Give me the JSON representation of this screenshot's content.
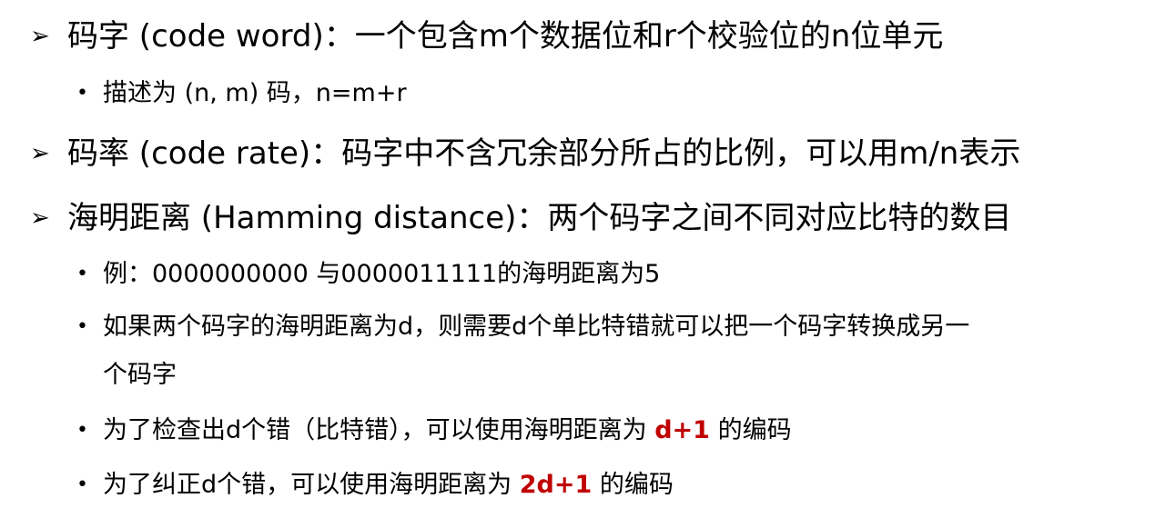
{
  "bullets": {
    "level1_marker": "➢",
    "level2_marker": "•"
  },
  "items": [
    {
      "level": 1,
      "text": "码字 (code word)：一个包含m个数据位和r个校验位的n位单元"
    },
    {
      "level": 2,
      "text": "描述为 (n, m) 码，n=m+r"
    },
    {
      "level": 1,
      "text": "码率 (code rate)：码字中不含冗余部分所占的比例，可以用m/n表示"
    },
    {
      "level": 1,
      "text": "海明距离 (Hamming distance)：两个码字之间不同对应比特的数目"
    },
    {
      "level": 2,
      "text": "例：0000000000 与0000011111的海明距离为5"
    },
    {
      "level": 2,
      "text_line1": "如果两个码字的海明距离为d，则需要d个单比特错就可以把一个码字转换成另一",
      "text_line2": "个码字"
    },
    {
      "level": 2,
      "before": "为了检查出d个错（比特错），可以使用海明距离为 ",
      "highlight": "d+1",
      "after": " 的编码"
    },
    {
      "level": 2,
      "before": "为了纠正d个错，可以使用海明距离为 ",
      "highlight": "2d+1",
      "after": " 的编码"
    }
  ],
  "colors": {
    "text": "#000000",
    "highlight": "#c00000",
    "background": "#ffffff"
  }
}
